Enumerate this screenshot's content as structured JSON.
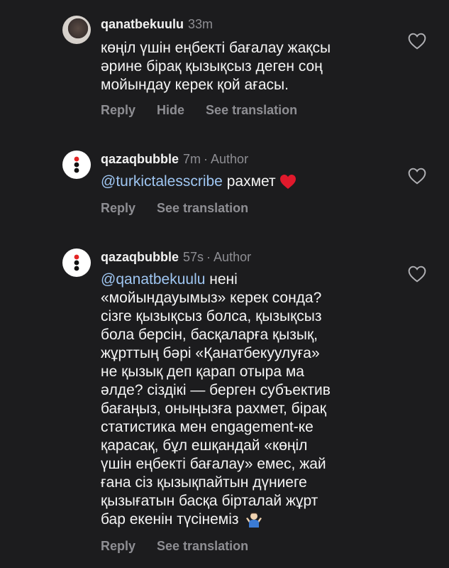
{
  "comments": [
    {
      "username": "qanatbekuulu",
      "time": "33m",
      "author_tag": "",
      "mention": "",
      "lines": [
        "көңіл үшін еңбекті бағалау жақсы",
        "әрине бірақ қызықсыз деген соң",
        "мойындау керек қой ағасы."
      ],
      "actions": {
        "reply": "Reply",
        "hide": "Hide",
        "translate": "See translation"
      }
    },
    {
      "username": "qazaqbubble",
      "time": "7m",
      "author_tag": "Author",
      "mention": "@turkictalesscribe",
      "text_after_mention": "рахмет",
      "emoji": "heart-emoji",
      "actions": {
        "reply": "Reply",
        "translate": "See translation"
      }
    },
    {
      "username": "qazaqbubble",
      "time": "57s",
      "author_tag": "Author",
      "mention": "@qanatbekuulu",
      "first_line_after_mention": "нені",
      "lines": [
        "«мойындауымыз» керек сонда?",
        "сізге қызықсыз болса, қызықсыз",
        "бола берсін, басқаларға қызық,",
        "жұрттың бәрі «Қанатбекуулуға»",
        "не қызық деп қарап отыра ма",
        "әлде? сіздікі — берген субъектив",
        "бағаңыз, оныңызға рахмет, бірақ",
        "статистика мен engagement-ке",
        "қарасақ, бұл ешқандай «көңіл",
        "үшін еңбекті бағалау» емес, жай",
        "ғана сіз қызықпайтын дүниеге",
        "қызығатын басқа бірталай жұрт",
        "бар екенін түсінеміз"
      ],
      "emoji": "shrug-emoji",
      "actions": {
        "reply": "Reply",
        "translate": "See translation"
      }
    }
  ],
  "colors": {
    "background": "#1c1c1e",
    "muted": "#8e8e93",
    "mention": "#9fc6f2",
    "heart_emoji": "#e0192c"
  }
}
